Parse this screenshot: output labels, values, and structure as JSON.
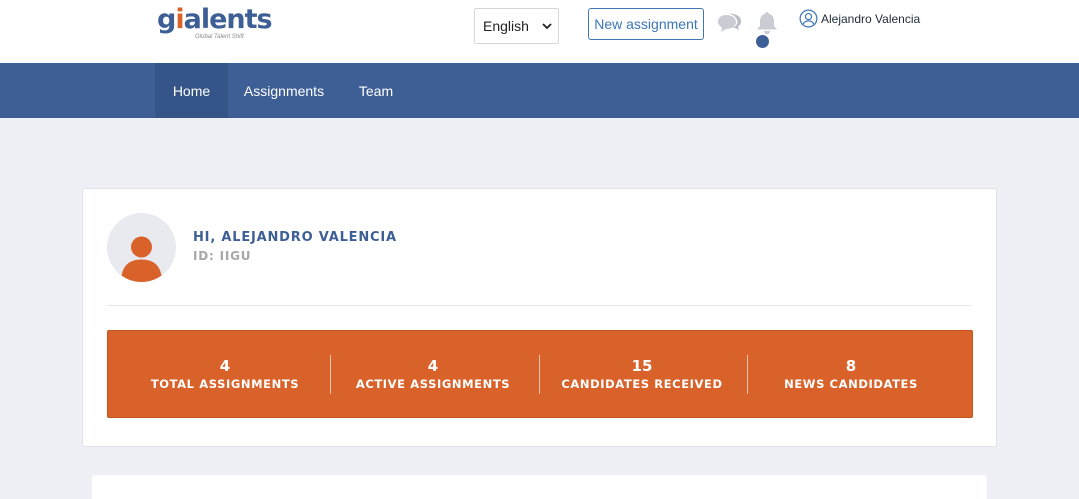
{
  "brand": {
    "logo_text": "giialents",
    "tagline": "Global Talent Shift",
    "accent_color": "#3d5f96",
    "orange_color": "#d9622b"
  },
  "header": {
    "language_selected": "English",
    "new_assignment_label": "New assignment",
    "user_name": "Alejandro Valencia",
    "icons": [
      "chat-icon",
      "bell-icon",
      "user-circle-icon",
      "chevron-down-icon"
    ]
  },
  "nav": {
    "items": [
      {
        "label": "Home",
        "active": true
      },
      {
        "label": "Assignments",
        "active": false
      },
      {
        "label": "Team",
        "active": false
      }
    ]
  },
  "profile": {
    "greeting": "HI, ALEJANDRO VALENCIA",
    "id_text": "ID: IIGU"
  },
  "stats": [
    {
      "value": "4",
      "label": "TOTAL ASSIGNMENTS"
    },
    {
      "value": "4",
      "label": "ACTIVE ASSIGNMENTS"
    },
    {
      "value": "15",
      "label": "CANDIDATES RECEIVED"
    },
    {
      "value": "8",
      "label": "NEWS CANDIDATES"
    }
  ]
}
